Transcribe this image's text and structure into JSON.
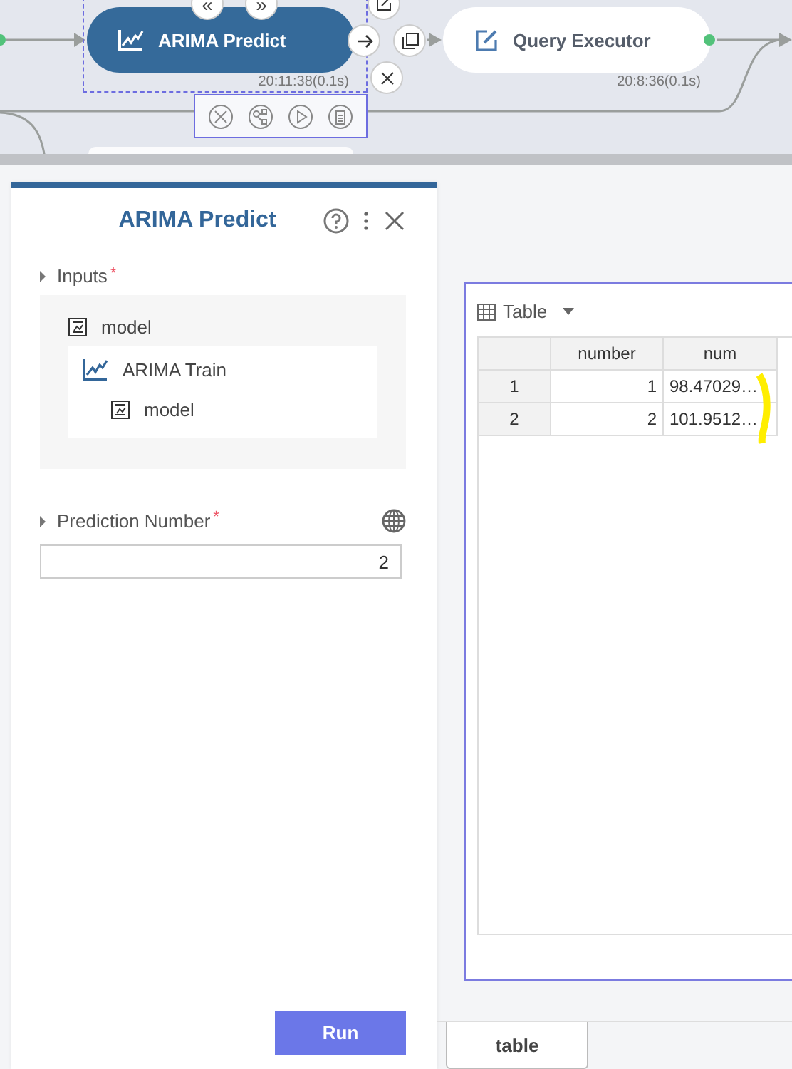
{
  "canvas": {
    "nodes": [
      {
        "label": "ARIMA Predict",
        "kind": "chart",
        "selected": true,
        "time": "20:11:38(0.1s)"
      },
      {
        "label": "Query Executor",
        "kind": "edit",
        "selected": false,
        "time": "20:8:36(0.1s)"
      }
    ],
    "nav_buttons": [
      "«",
      "»"
    ]
  },
  "panel": {
    "title": "ARIMA Predict",
    "inputs": {
      "label": "Inputs",
      "required_mark": "*",
      "expanded": false,
      "port": "model",
      "source": {
        "name": "ARIMA Train",
        "port": "model"
      }
    },
    "prediction_number": {
      "label": "Prediction Number",
      "required_mark": "*",
      "expanded": false,
      "value": "2"
    },
    "run_button": "Run"
  },
  "result": {
    "view": "Table",
    "columns": [
      "number",
      "num"
    ],
    "rows": [
      {
        "index": "1",
        "number": "1",
        "num": "98.47029…"
      },
      {
        "index": "2",
        "number": "2",
        "num": "101.9512…"
      }
    ]
  },
  "bottom_tabs": [
    {
      "label": "table",
      "selected": true
    }
  ]
}
